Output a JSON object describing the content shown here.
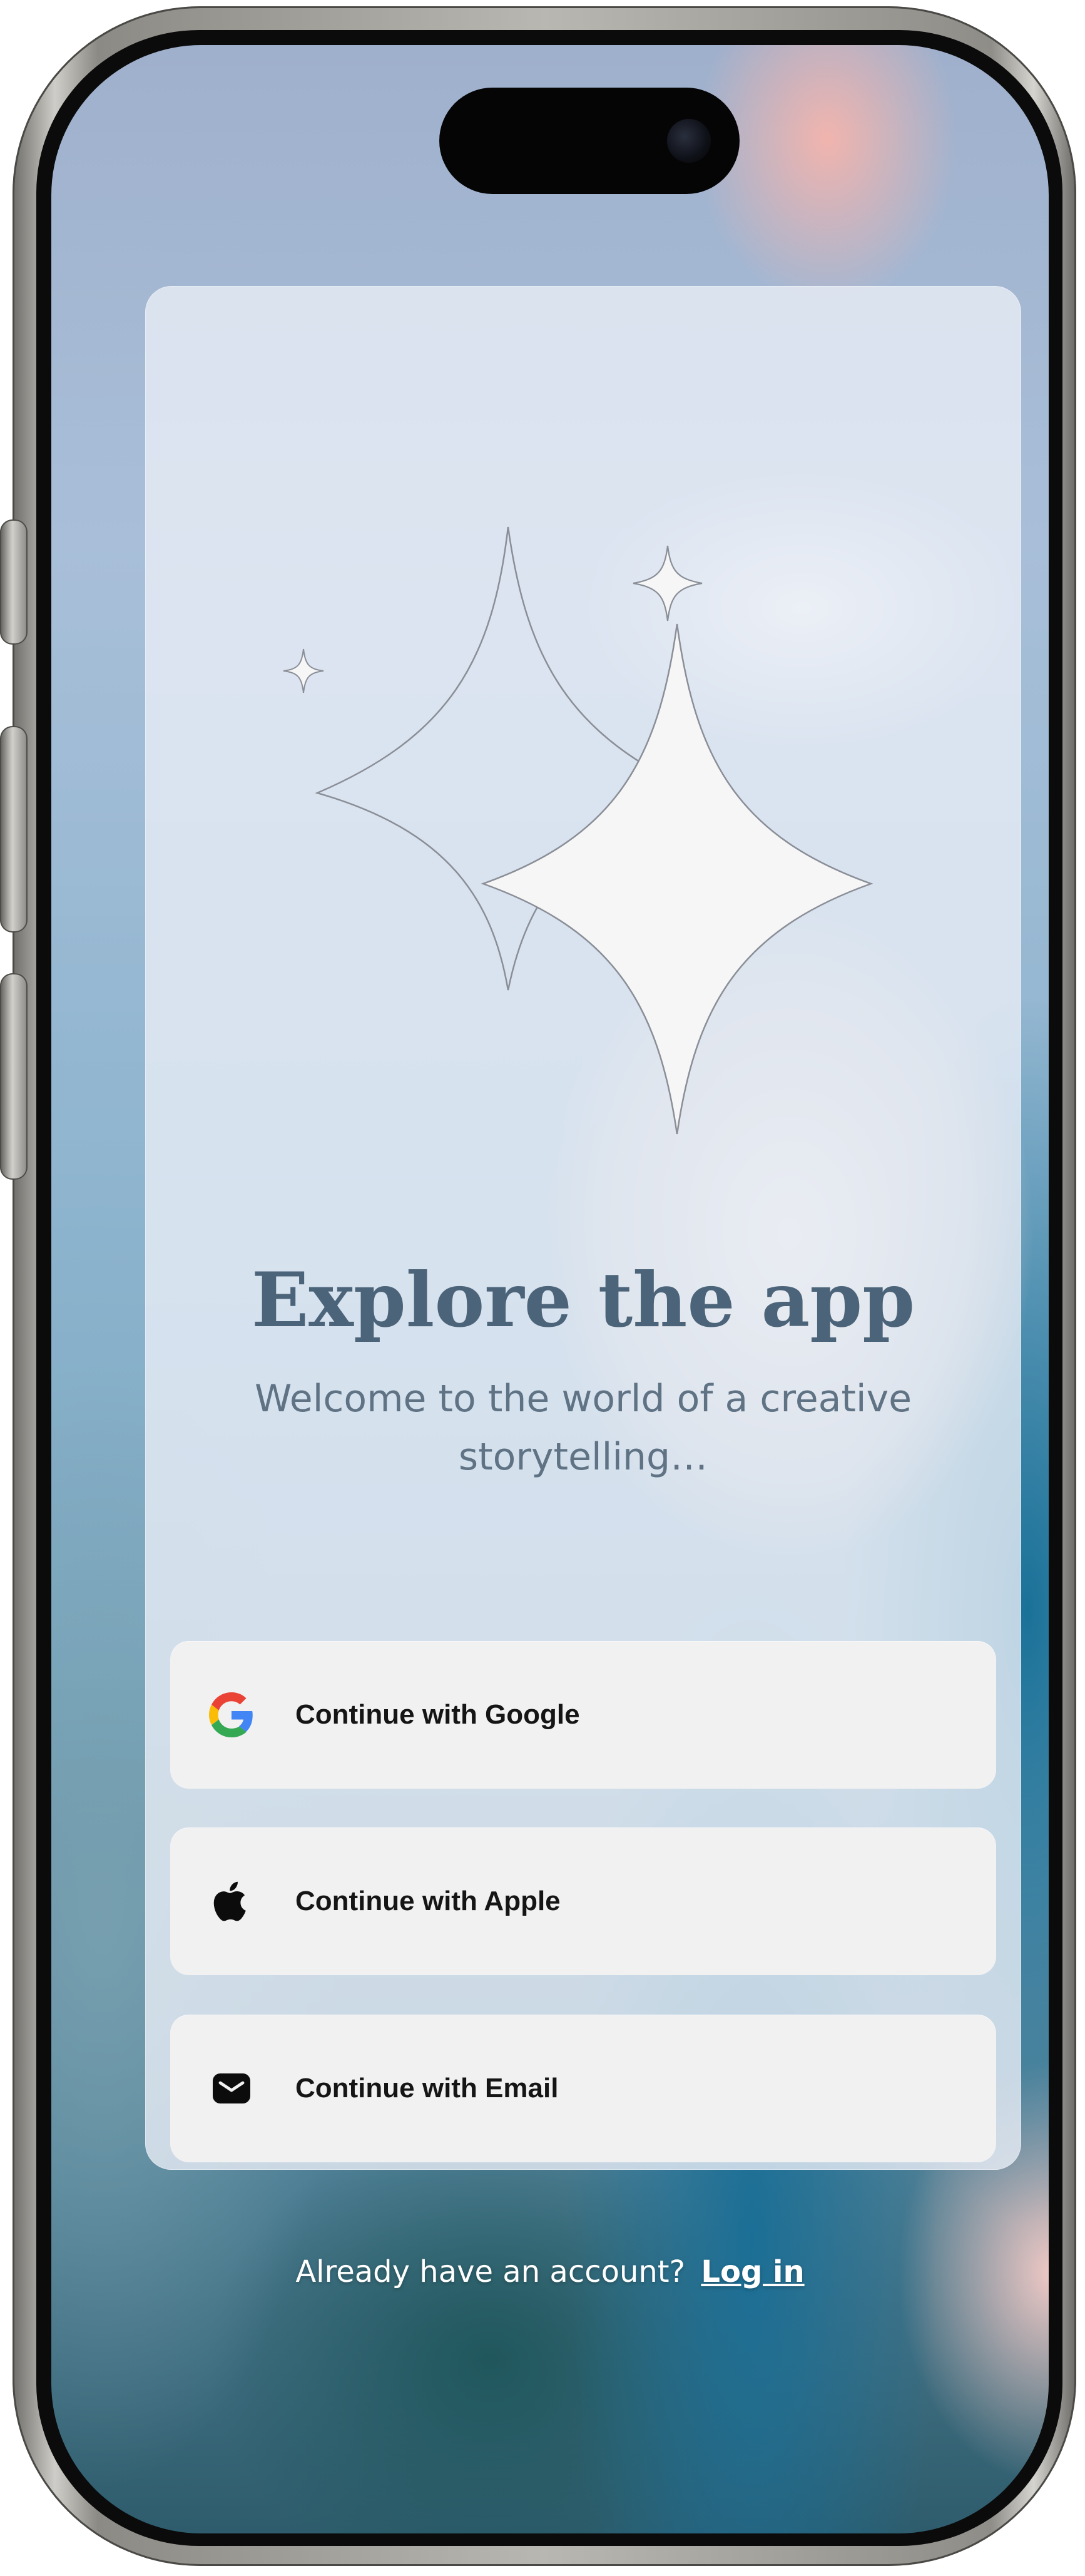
{
  "onboarding": {
    "title": "Explore the app",
    "subtitle": "Welcome to the world of a creative storytelling…",
    "icons": {
      "hero": "sparkles-icon"
    }
  },
  "auth": {
    "buttons": [
      {
        "id": "google",
        "label": "Continue with Google",
        "icon": "google-icon"
      },
      {
        "id": "apple",
        "label": "Continue with Apple",
        "icon": "apple-icon"
      },
      {
        "id": "email",
        "label": "Continue with Email",
        "icon": "email-icon"
      }
    ]
  },
  "footer": {
    "prompt": "Already have an account?",
    "link_label": "Log in"
  },
  "colors": {
    "title": "#4c6479",
    "subtitle": "#5f7385",
    "button_bg": "#f1f1f2",
    "google_blue": "#4285F4",
    "google_red": "#EA4335",
    "google_yellow": "#FBBC05",
    "google_green": "#34A853"
  }
}
